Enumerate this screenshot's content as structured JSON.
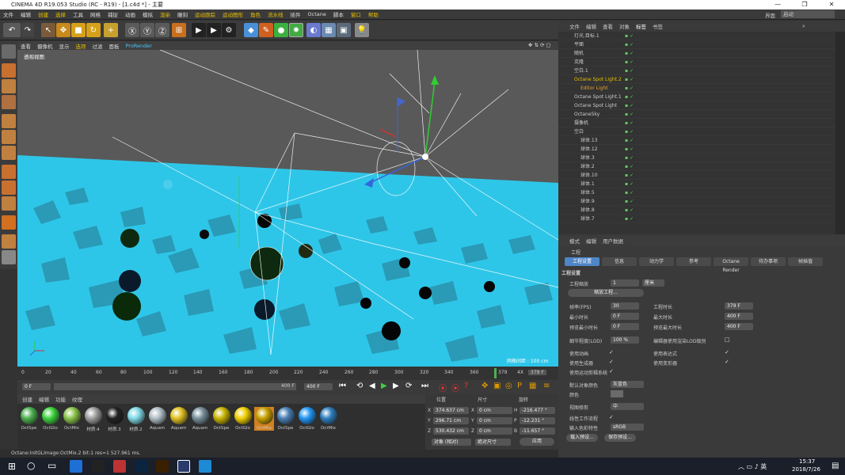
{
  "title": "CINEMA 4D R19.053 Studio (RC - R19) - [1.c4d *] - 主要",
  "menu": [
    "文件",
    "编辑",
    "创建",
    "选择",
    "工具",
    "网格",
    "捕捉",
    "动画",
    "模拟",
    "渲染",
    "雕刻",
    "运动跟踪",
    "运动图形",
    "角色",
    "流水线",
    "插件",
    "Octane",
    "脚本",
    "窗口",
    "帮助"
  ],
  "layout_label": "界面",
  "layout_value": "启动",
  "viewport_menu": [
    "查看",
    "摄像机",
    "显示",
    "选项",
    "过滤",
    "面板",
    "ProRender"
  ],
  "viewport_name": "透视视图",
  "grid_spacing": "网格间距 : 100 cm",
  "timeline_ticks": [
    "0",
    "20",
    "40",
    "60",
    "80",
    "100",
    "120",
    "140",
    "160",
    "180",
    "200",
    "220",
    "240",
    "260",
    "280",
    "300",
    "320",
    "340",
    "360",
    "379",
    "4X"
  ],
  "current_frame": "379",
  "end_frame_display": "379 F",
  "time_start": "0 F",
  "time_mid": "400 F",
  "time_end": "400 F",
  "material_tabs": [
    "创建",
    "编辑",
    "功能",
    "纹理"
  ],
  "materials": [
    {
      "name": "OctSpe",
      "color": "#4caf50"
    },
    {
      "name": "OctGlo",
      "color": "#3cd43c"
    },
    {
      "name": "OctMix",
      "color": "#8bc34a"
    },
    {
      "name": "材质.4",
      "color": "#9e9e9e"
    },
    {
      "name": "材质.3",
      "color": "#222222"
    },
    {
      "name": "材质.2",
      "color": "#7fd8e6"
    },
    {
      "name": "Aquam",
      "color": "#b0bec5"
    },
    {
      "name": "Aquam",
      "color": "#e0c020"
    },
    {
      "name": "Aquam",
      "color": "#78909c"
    },
    {
      "name": "OctSpe",
      "color": "#c8b400"
    },
    {
      "name": "OctGlo",
      "color": "#f2d000"
    },
    {
      "name": "OctMix",
      "color": "#c9a000"
    },
    {
      "name": "OctSpe",
      "color": "#4a7fb5"
    },
    {
      "name": "OctGlo",
      "color": "#2196f3"
    },
    {
      "name": "OctMix",
      "color": "#2e7dbd"
    }
  ],
  "coords": {
    "headers": [
      "位置",
      "尺寸",
      "旋转"
    ],
    "rows": [
      {
        "axis": "X",
        "pos": "374.637 cm",
        "sizeAxis": "X",
        "size": "0 cm",
        "rotAxis": "H",
        "rot": "-216.477 °"
      },
      {
        "axis": "Y",
        "pos": "296.71 cm",
        "sizeAxis": "Y",
        "size": "0 cm",
        "rotAxis": "P",
        "rot": "-12.231 °"
      },
      {
        "axis": "Z",
        "pos": "530.432 cm",
        "sizeAxis": "Z",
        "size": "0 cm",
        "rotAxis": "B",
        "rot": "-11.657 °"
      }
    ],
    "mode1": "对象 (相对)",
    "mode2": "绝对尺寸",
    "apply": "应用"
  },
  "status": "Octane:InitGLImage:OctMix.2  bit:1 res=1  527.961 ms.",
  "obj_tabs": [
    "文件",
    "编辑",
    "查看",
    "对象",
    "标签",
    "书签"
  ],
  "objects": [
    "灯光.目标.1",
    "平面",
    "随机",
    "克隆",
    "空白.1",
    "Octane Spot Light.2",
    "Editor Light",
    "Octane Spot Light.1",
    "Octane Spot Light",
    "OctaneSky",
    "摄像机",
    "空白",
    "球体.13",
    "球体.12",
    "球体.3",
    "球体.2",
    "球体.10",
    "球体.1",
    "球体.5",
    "球体.9",
    "球体.8",
    "球体.7"
  ],
  "attr_tabs": [
    "模式",
    "编辑",
    "用户数据"
  ],
  "project_label": "工程",
  "attr_sections": [
    "工程设置",
    "信息",
    "动力学",
    "参考",
    "Octane Render",
    "待办事项",
    "帧插值"
  ],
  "project_settings_label": "工程设置",
  "settings": {
    "scale_label": "工程缩放",
    "scale_value": "1",
    "scale_unit": "厘米",
    "scale_btn": "缩放工程...",
    "fps_label": "帧率(FPS)",
    "fps": "30",
    "proj_len_label": "工程时长",
    "proj_len": "379 F",
    "min_time_label": "最小时长",
    "min_time": "0 F",
    "max_time_label": "最大时长",
    "max_time": "400 F",
    "prev_min_label": "预览最小时长",
    "prev_min": "0 F",
    "prev_max_label": "预览最大时长",
    "prev_max": "400 F",
    "lod_label": "细节程度(LOD)",
    "lod": "100 %",
    "lod_render_label": "编辑器使用渲染LOD级别",
    "use_anim": "使用动画",
    "use_expr": "使用表达式",
    "use_gen": "使用生成器",
    "use_deform": "使用变形器",
    "use_mograph": "使用运动剪辑系统",
    "default_color_label": "默认对象颜色",
    "default_color": "灰蓝色",
    "color_label": "颜色",
    "view_clip_label": "视图修剪",
    "view_clip": "中",
    "linear_label": "线性工作流程",
    "input_color_label": "输入色彩特性",
    "input_color": "sRGB",
    "load_preset": "载入预设...",
    "save_preset": "保存预设..."
  },
  "clock_time": "15:37",
  "clock_date": "2018/7/26"
}
